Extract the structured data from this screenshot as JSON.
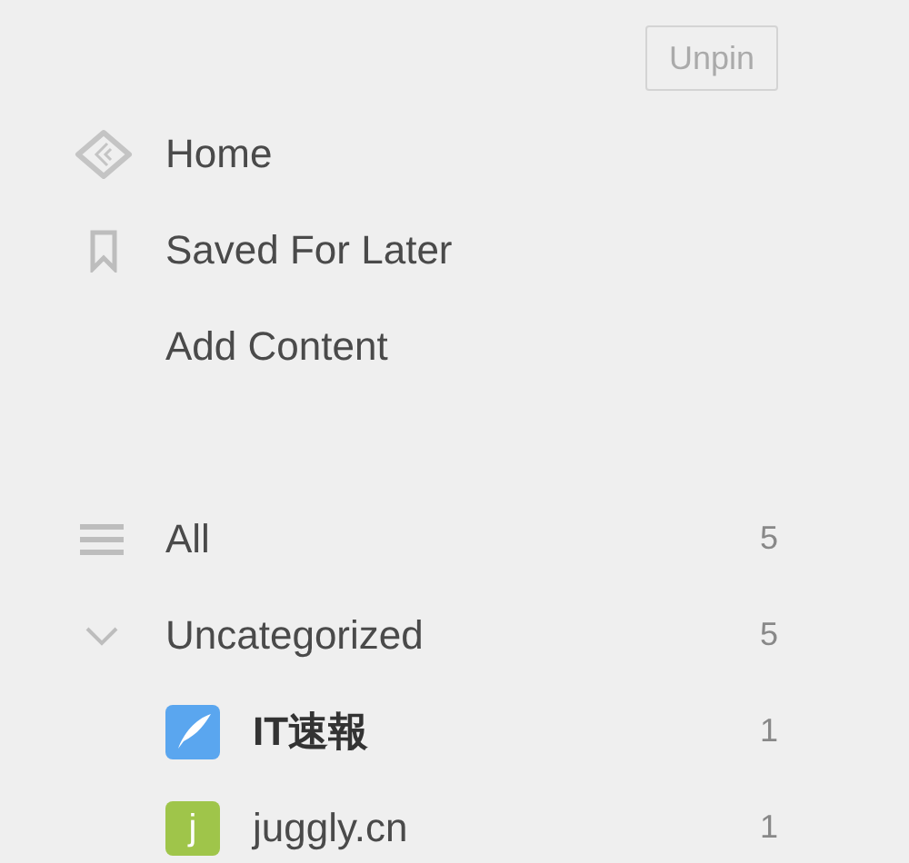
{
  "unpin_button": "Unpin",
  "nav": [
    {
      "kind": "home",
      "label": "Home"
    },
    {
      "kind": "saved",
      "label": "Saved For Later"
    },
    {
      "kind": "add",
      "label": "Add Content"
    }
  ],
  "all": {
    "label": "All",
    "count": "5"
  },
  "category": {
    "label": "Uncategorized",
    "count": "5",
    "expanded": true,
    "feeds": [
      {
        "kind": "quill",
        "name": "IT速報",
        "count": "1",
        "unread": true
      },
      {
        "kind": "letter",
        "letter": "j",
        "name": "juggly.cn",
        "count": "1",
        "unread": false
      }
    ]
  }
}
